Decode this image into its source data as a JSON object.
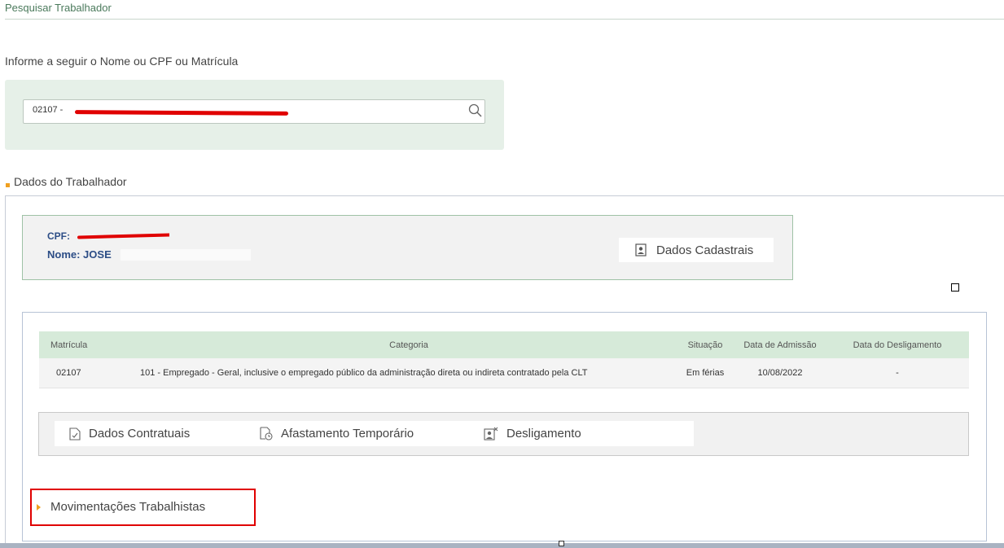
{
  "page": {
    "title": "Pesquisar Trabalhador",
    "instruction": "Informe a seguir o Nome ou CPF ou Matrícula"
  },
  "search": {
    "value": "02107 - ",
    "icon": "search-icon"
  },
  "section": {
    "title": "Dados do Trabalhador"
  },
  "worker": {
    "cpf_label": "CPF:",
    "nome_label": "Nome: JOSE",
    "dados_cadastrais_label": "Dados Cadastrais"
  },
  "contracts": {
    "headers": [
      "Matrícula",
      "Categoria",
      "Situação",
      "Data de Admissão",
      "Data do Desligamento"
    ],
    "rows": [
      [
        "02107",
        "101 - Empregado - Geral, inclusive o empregado público da administração direta ou indireta contratado pela CLT",
        "Em férias",
        "10/08/2022",
        "-"
      ]
    ]
  },
  "actions": {
    "dados_contratuais": "Dados Contratuais",
    "afastamento": "Afastamento Temporário",
    "desligamento": "Desligamento"
  },
  "movimentacoes": {
    "label": "Movimentações Trabalhistas"
  },
  "colors": {
    "accent_green": "#d6ead9",
    "label_blue": "#2c4d86",
    "highlight_red": "#e00000",
    "bullet_orange": "#f0a020"
  }
}
